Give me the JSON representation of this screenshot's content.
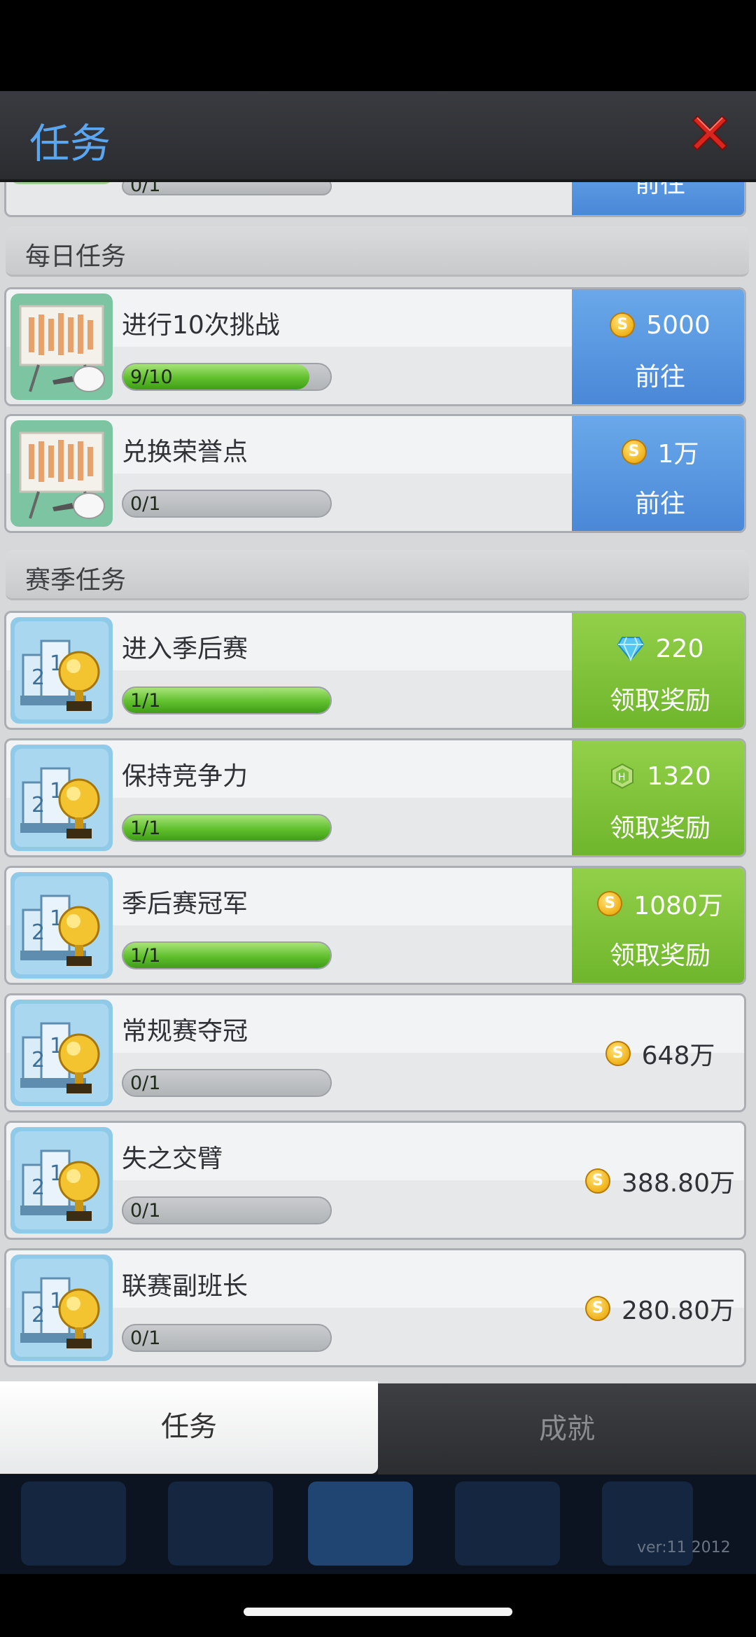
{
  "header": {
    "title": "任务"
  },
  "sections": {
    "daily": "每日任务",
    "season": "赛季任务"
  },
  "partial_task": {
    "action": "前往",
    "progress": "0/1"
  },
  "tasks": [
    {
      "title": "进行10次挑战",
      "progress": "9/10",
      "progress_fraction": 0.9,
      "reward_type": "coin",
      "reward": "5000",
      "action": "前往",
      "state": "go",
      "icon": "tactics-board-icon"
    },
    {
      "title": "兑换荣誉点",
      "progress": "0/1",
      "progress_fraction": 0,
      "reward_type": "coin",
      "reward": "1万",
      "action": "前往",
      "state": "go",
      "icon": "tactics-board-icon"
    },
    {
      "title": "进入季后赛",
      "progress": "1/1",
      "progress_fraction": 1,
      "reward_type": "diamond",
      "reward": "220",
      "action": "领取奖励",
      "state": "claim",
      "icon": "trophy-icon"
    },
    {
      "title": "保持竞争力",
      "progress": "1/1",
      "progress_fraction": 1,
      "reward_type": "hex-token",
      "reward": "1320",
      "action": "领取奖励",
      "state": "claim",
      "icon": "trophy-icon"
    },
    {
      "title": "季后赛冠军",
      "progress": "1/1",
      "progress_fraction": 1,
      "reward_type": "coin",
      "reward": "1080万",
      "action": "领取奖励",
      "state": "claim",
      "icon": "trophy-icon"
    },
    {
      "title": "常规赛夺冠",
      "progress": "0/1",
      "progress_fraction": 0,
      "reward_type": "coin",
      "reward": "648万",
      "action": "",
      "state": "plain",
      "icon": "trophy-icon"
    },
    {
      "title": "失之交臂",
      "progress": "0/1",
      "progress_fraction": 0,
      "reward_type": "coin",
      "reward": "388.80万",
      "action": "",
      "state": "plain",
      "icon": "trophy-icon"
    },
    {
      "title": "联赛副班长",
      "progress": "0/1",
      "progress_fraction": 0,
      "reward_type": "coin",
      "reward": "280.80万",
      "action": "",
      "state": "plain",
      "icon": "trophy-icon"
    }
  ],
  "tabs": {
    "tasks": "任务",
    "achievements": "成就"
  },
  "version": "ver:11  2012",
  "colors": {
    "title_blue": "#5aa6f0",
    "go_blue": "#4a88d8",
    "claim_green": "#6fb62c",
    "close_red": "#d8261e"
  }
}
